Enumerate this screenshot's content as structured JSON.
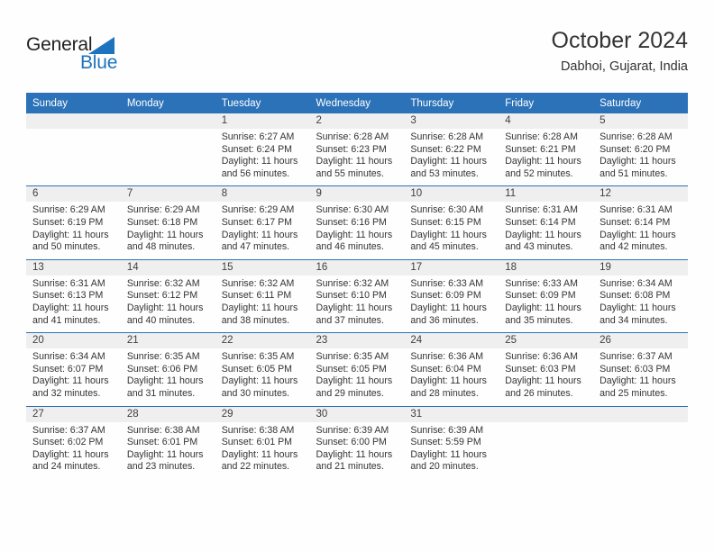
{
  "brand": {
    "name_line1": "General",
    "name_line2": "Blue",
    "triangle_icon": "triangle-logo-icon",
    "color_dark": "#231f20",
    "color_blue": "#1e73be"
  },
  "header": {
    "title": "October 2024",
    "subtitle": "Dabhoi, Gujarat, India"
  },
  "theme": {
    "header_blue": "#2c72b8",
    "daynum_gray": "#efefef",
    "text": "#333333"
  },
  "weekdays": [
    "Sunday",
    "Monday",
    "Tuesday",
    "Wednesday",
    "Thursday",
    "Friday",
    "Saturday"
  ],
  "weeks": [
    [
      {
        "day": "",
        "blank": true
      },
      {
        "day": "",
        "blank": true
      },
      {
        "day": "1",
        "sunrise": "Sunrise: 6:27 AM",
        "sunset": "Sunset: 6:24 PM",
        "daylight_1": "Daylight: 11 hours",
        "daylight_2": "and 56 minutes."
      },
      {
        "day": "2",
        "sunrise": "Sunrise: 6:28 AM",
        "sunset": "Sunset: 6:23 PM",
        "daylight_1": "Daylight: 11 hours",
        "daylight_2": "and 55 minutes."
      },
      {
        "day": "3",
        "sunrise": "Sunrise: 6:28 AM",
        "sunset": "Sunset: 6:22 PM",
        "daylight_1": "Daylight: 11 hours",
        "daylight_2": "and 53 minutes."
      },
      {
        "day": "4",
        "sunrise": "Sunrise: 6:28 AM",
        "sunset": "Sunset: 6:21 PM",
        "daylight_1": "Daylight: 11 hours",
        "daylight_2": "and 52 minutes."
      },
      {
        "day": "5",
        "sunrise": "Sunrise: 6:28 AM",
        "sunset": "Sunset: 6:20 PM",
        "daylight_1": "Daylight: 11 hours",
        "daylight_2": "and 51 minutes."
      }
    ],
    [
      {
        "day": "6",
        "sunrise": "Sunrise: 6:29 AM",
        "sunset": "Sunset: 6:19 PM",
        "daylight_1": "Daylight: 11 hours",
        "daylight_2": "and 50 minutes."
      },
      {
        "day": "7",
        "sunrise": "Sunrise: 6:29 AM",
        "sunset": "Sunset: 6:18 PM",
        "daylight_1": "Daylight: 11 hours",
        "daylight_2": "and 48 minutes."
      },
      {
        "day": "8",
        "sunrise": "Sunrise: 6:29 AM",
        "sunset": "Sunset: 6:17 PM",
        "daylight_1": "Daylight: 11 hours",
        "daylight_2": "and 47 minutes."
      },
      {
        "day": "9",
        "sunrise": "Sunrise: 6:30 AM",
        "sunset": "Sunset: 6:16 PM",
        "daylight_1": "Daylight: 11 hours",
        "daylight_2": "and 46 minutes."
      },
      {
        "day": "10",
        "sunrise": "Sunrise: 6:30 AM",
        "sunset": "Sunset: 6:15 PM",
        "daylight_1": "Daylight: 11 hours",
        "daylight_2": "and 45 minutes."
      },
      {
        "day": "11",
        "sunrise": "Sunrise: 6:31 AM",
        "sunset": "Sunset: 6:14 PM",
        "daylight_1": "Daylight: 11 hours",
        "daylight_2": "and 43 minutes."
      },
      {
        "day": "12",
        "sunrise": "Sunrise: 6:31 AM",
        "sunset": "Sunset: 6:14 PM",
        "daylight_1": "Daylight: 11 hours",
        "daylight_2": "and 42 minutes."
      }
    ],
    [
      {
        "day": "13",
        "sunrise": "Sunrise: 6:31 AM",
        "sunset": "Sunset: 6:13 PM",
        "daylight_1": "Daylight: 11 hours",
        "daylight_2": "and 41 minutes."
      },
      {
        "day": "14",
        "sunrise": "Sunrise: 6:32 AM",
        "sunset": "Sunset: 6:12 PM",
        "daylight_1": "Daylight: 11 hours",
        "daylight_2": "and 40 minutes."
      },
      {
        "day": "15",
        "sunrise": "Sunrise: 6:32 AM",
        "sunset": "Sunset: 6:11 PM",
        "daylight_1": "Daylight: 11 hours",
        "daylight_2": "and 38 minutes."
      },
      {
        "day": "16",
        "sunrise": "Sunrise: 6:32 AM",
        "sunset": "Sunset: 6:10 PM",
        "daylight_1": "Daylight: 11 hours",
        "daylight_2": "and 37 minutes."
      },
      {
        "day": "17",
        "sunrise": "Sunrise: 6:33 AM",
        "sunset": "Sunset: 6:09 PM",
        "daylight_1": "Daylight: 11 hours",
        "daylight_2": "and 36 minutes."
      },
      {
        "day": "18",
        "sunrise": "Sunrise: 6:33 AM",
        "sunset": "Sunset: 6:09 PM",
        "daylight_1": "Daylight: 11 hours",
        "daylight_2": "and 35 minutes."
      },
      {
        "day": "19",
        "sunrise": "Sunrise: 6:34 AM",
        "sunset": "Sunset: 6:08 PM",
        "daylight_1": "Daylight: 11 hours",
        "daylight_2": "and 34 minutes."
      }
    ],
    [
      {
        "day": "20",
        "sunrise": "Sunrise: 6:34 AM",
        "sunset": "Sunset: 6:07 PM",
        "daylight_1": "Daylight: 11 hours",
        "daylight_2": "and 32 minutes."
      },
      {
        "day": "21",
        "sunrise": "Sunrise: 6:35 AM",
        "sunset": "Sunset: 6:06 PM",
        "daylight_1": "Daylight: 11 hours",
        "daylight_2": "and 31 minutes."
      },
      {
        "day": "22",
        "sunrise": "Sunrise: 6:35 AM",
        "sunset": "Sunset: 6:05 PM",
        "daylight_1": "Daylight: 11 hours",
        "daylight_2": "and 30 minutes."
      },
      {
        "day": "23",
        "sunrise": "Sunrise: 6:35 AM",
        "sunset": "Sunset: 6:05 PM",
        "daylight_1": "Daylight: 11 hours",
        "daylight_2": "and 29 minutes."
      },
      {
        "day": "24",
        "sunrise": "Sunrise: 6:36 AM",
        "sunset": "Sunset: 6:04 PM",
        "daylight_1": "Daylight: 11 hours",
        "daylight_2": "and 28 minutes."
      },
      {
        "day": "25",
        "sunrise": "Sunrise: 6:36 AM",
        "sunset": "Sunset: 6:03 PM",
        "daylight_1": "Daylight: 11 hours",
        "daylight_2": "and 26 minutes."
      },
      {
        "day": "26",
        "sunrise": "Sunrise: 6:37 AM",
        "sunset": "Sunset: 6:03 PM",
        "daylight_1": "Daylight: 11 hours",
        "daylight_2": "and 25 minutes."
      }
    ],
    [
      {
        "day": "27",
        "sunrise": "Sunrise: 6:37 AM",
        "sunset": "Sunset: 6:02 PM",
        "daylight_1": "Daylight: 11 hours",
        "daylight_2": "and 24 minutes."
      },
      {
        "day": "28",
        "sunrise": "Sunrise: 6:38 AM",
        "sunset": "Sunset: 6:01 PM",
        "daylight_1": "Daylight: 11 hours",
        "daylight_2": "and 23 minutes."
      },
      {
        "day": "29",
        "sunrise": "Sunrise: 6:38 AM",
        "sunset": "Sunset: 6:01 PM",
        "daylight_1": "Daylight: 11 hours",
        "daylight_2": "and 22 minutes."
      },
      {
        "day": "30",
        "sunrise": "Sunrise: 6:39 AM",
        "sunset": "Sunset: 6:00 PM",
        "daylight_1": "Daylight: 11 hours",
        "daylight_2": "and 21 minutes."
      },
      {
        "day": "31",
        "sunrise": "Sunrise: 6:39 AM",
        "sunset": "Sunset: 5:59 PM",
        "daylight_1": "Daylight: 11 hours",
        "daylight_2": "and 20 minutes."
      },
      {
        "day": "",
        "blank": true
      },
      {
        "day": "",
        "blank": true
      }
    ]
  ]
}
